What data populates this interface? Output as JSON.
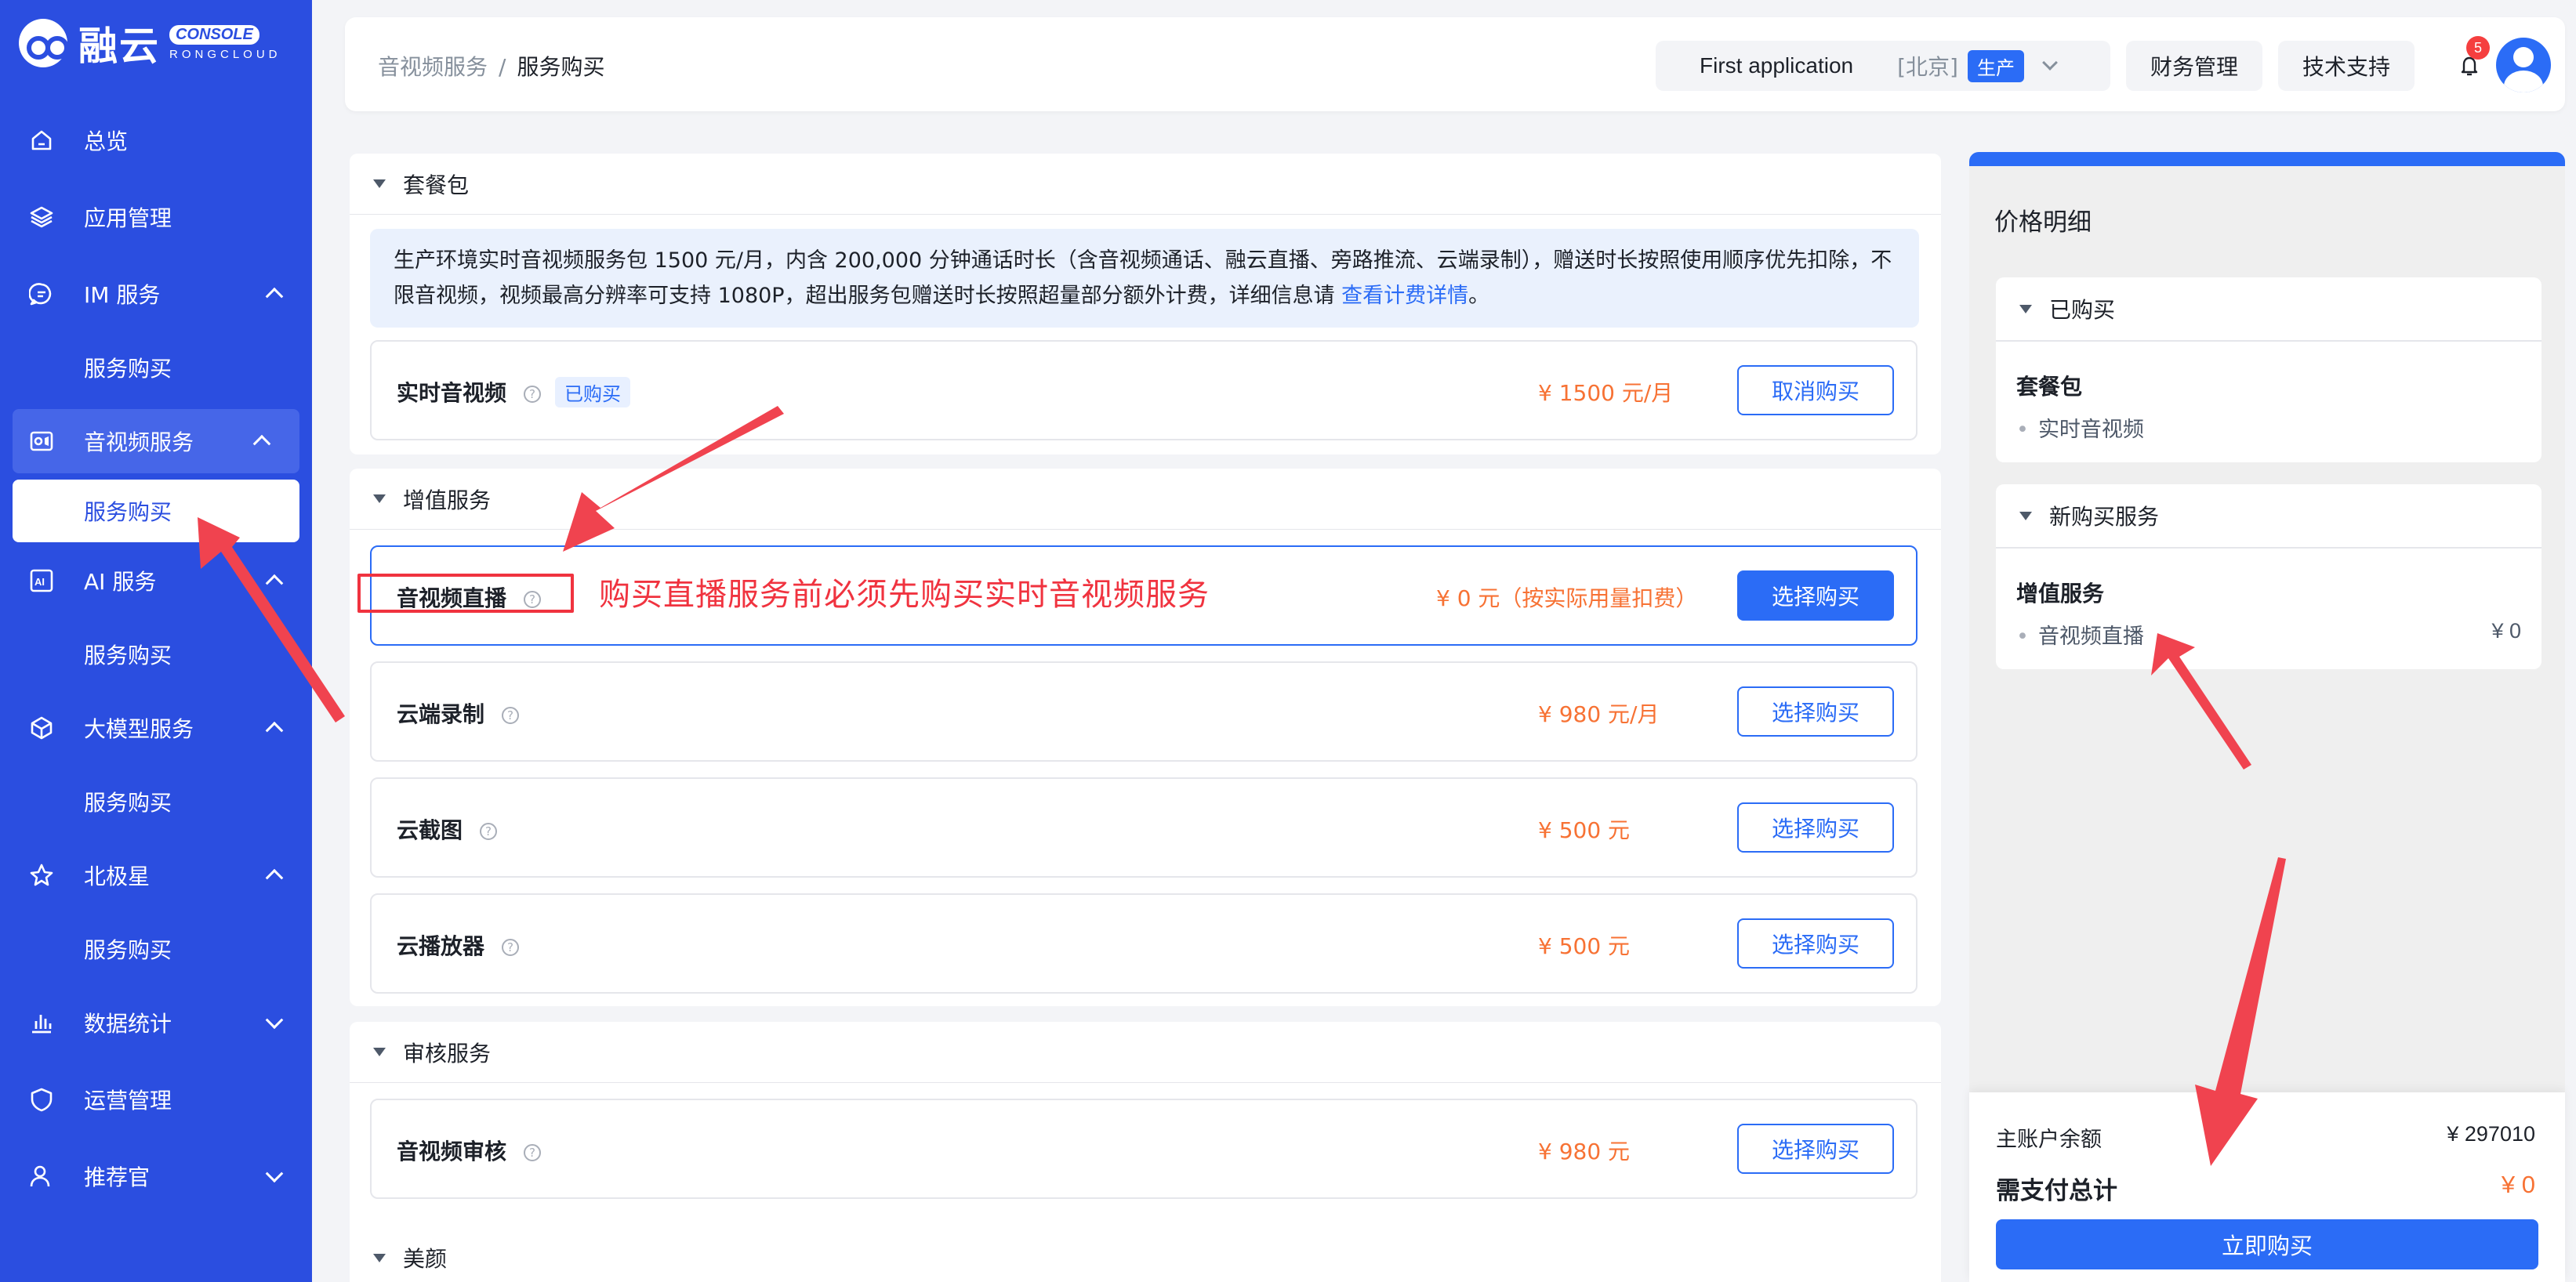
{
  "brand": {
    "name_cn": "融云",
    "console": "CONSOLE",
    "rongcloud": "RONGCLOUD"
  },
  "sidebar": {
    "items": [
      {
        "label": "总览",
        "icon": "home-icon"
      },
      {
        "label": "应用管理",
        "icon": "layers-icon"
      },
      {
        "label": "IM 服务",
        "icon": "chat-icon"
      },
      {
        "label": "服务购买"
      },
      {
        "label": "音视频服务",
        "icon": "video-icon"
      },
      {
        "label": "服务购买"
      },
      {
        "label": "AI 服务",
        "icon": "ai-icon"
      },
      {
        "label": "服务购买"
      },
      {
        "label": "大模型服务",
        "icon": "cube-icon"
      },
      {
        "label": "服务购买"
      },
      {
        "label": "北极星",
        "icon": "star-icon"
      },
      {
        "label": "服务购买"
      },
      {
        "label": "数据统计",
        "icon": "chart-icon"
      },
      {
        "label": "运营管理",
        "icon": "shield-icon"
      },
      {
        "label": "推荐官",
        "icon": "user-icon"
      }
    ]
  },
  "header": {
    "breadcrumb": [
      "音视频服务",
      "服务购买"
    ],
    "sep": "/",
    "app_name": "First application",
    "region": "[北京]",
    "env": "生产",
    "finance": "财务管理",
    "support": "技术支持",
    "notifications": "5"
  },
  "sections": {
    "package": {
      "title": "套餐包",
      "notice": "生产环境实时音视频服务包 1500 元/月，内含 200,000 分钟通话时长（含音视频通话、融云直播、旁路推流、云端录制），赠送时长按照使用顺序优先扣除，不限音视频，视频最高分辨率可支持 1080P，超出服务包赠送时长按照超量部分额外计费，详细信息请 ",
      "notice_link": "查看计费详情",
      "notice_end": "。",
      "items": [
        {
          "name": "实时音视频",
          "tag": "已购买",
          "price": "¥ 1500 元/月",
          "action": "取消购买"
        }
      ]
    },
    "value_added": {
      "title": "增值服务",
      "items": [
        {
          "name": "音视频直播",
          "price": "¥ 0 元（按实际用量扣费）",
          "action": "选择购买"
        },
        {
          "name": "云端录制",
          "price": "¥ 980 元/月",
          "action": "选择购买"
        },
        {
          "name": "云截图",
          "price": "¥ 500 元",
          "action": "选择购买"
        },
        {
          "name": "云播放器",
          "price": "¥ 500 元",
          "action": "选择购买"
        }
      ]
    },
    "audit": {
      "title": "审核服务",
      "items": [
        {
          "name": "音视频审核",
          "price": "¥ 980 元",
          "action": "选择购买"
        }
      ]
    },
    "beauty": {
      "title": "美颜"
    }
  },
  "help_glyph": "?",
  "annotation": "购买直播服务前必须先购买实时音视频服务",
  "price_panel": {
    "title": "价格明细",
    "purchased": {
      "title": "已购买",
      "group": "套餐包",
      "items": [
        "实时音视频"
      ]
    },
    "new": {
      "title": "新购买服务",
      "group": "增值服务",
      "items": [
        {
          "name": "音视频直播",
          "price": "¥ 0"
        }
      ]
    },
    "balance_label": "主账户余额",
    "balance": "¥ 297010",
    "total_label": "需支付总计",
    "total": "¥ 0",
    "buy": "立即购买"
  },
  "colors": {
    "sidebar": "#2b4ee0",
    "primary": "#2b6cf6",
    "price": "#f77234",
    "annotation": "#f0333f"
  }
}
